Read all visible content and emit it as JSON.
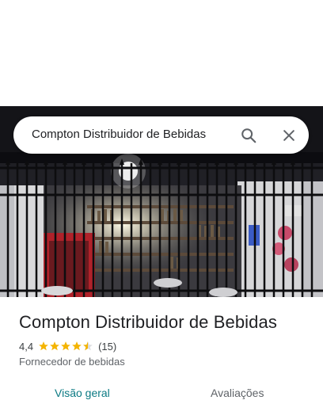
{
  "search": {
    "query": "Compton Distribuidor de Bebidas",
    "search_icon": "search-icon",
    "close_icon": "close-icon"
  },
  "photo": {
    "subject": "storefront-photo"
  },
  "place": {
    "name": "Compton Distribuidor de Bebidas",
    "rating": "4,4",
    "stars": 4.4,
    "review_count": "(15)",
    "category": "Fornecedor de bebidas"
  },
  "tabs": [
    {
      "label": "Visão geral",
      "active": true
    },
    {
      "label": "Avaliações",
      "active": false
    }
  ],
  "colors": {
    "star": "#f4b400",
    "active_tab": "#0b7a83",
    "text_primary": "#202124",
    "text_secondary": "#5f6368"
  }
}
